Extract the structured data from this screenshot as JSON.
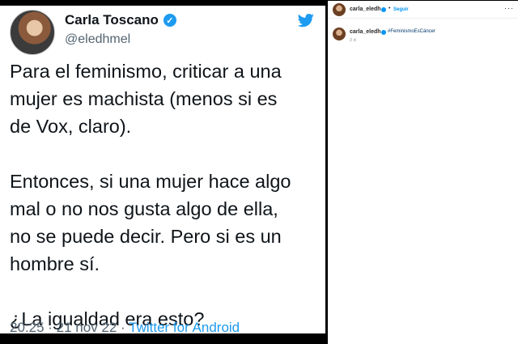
{
  "tweet": {
    "name": "Carla Toscano",
    "handle": "@eledhmel",
    "paragraphs": [
      [
        "Para el feminismo, criticar a una",
        "mujer es machista (menos si es",
        "de Vox, claro)."
      ],
      [
        "Entonces, si una mujer hace algo",
        "mal o no nos gusta algo de ella,",
        "no se puede decir. Pero si es un",
        "hombre sí."
      ],
      [
        "¿La igualdad era esto?"
      ]
    ],
    "timestamp": "20:25 · 21 nov 22 · ",
    "source": "Twitter for Android"
  },
  "instagram": {
    "header": {
      "username": "carla_eledh",
      "separator": "•",
      "follow_label": "Seguir",
      "more_label": "···"
    },
    "caption": {
      "username": "carla_eledh",
      "hashtag": "#FeminismoEsCáncer",
      "time": "2 d"
    }
  },
  "colors": {
    "twitter_blue": "#1d9bf0",
    "instagram_blue": "#0095f6"
  },
  "icons": [
    "twitter-bird-icon",
    "verified-badge-icon",
    "more-options-icon"
  ]
}
